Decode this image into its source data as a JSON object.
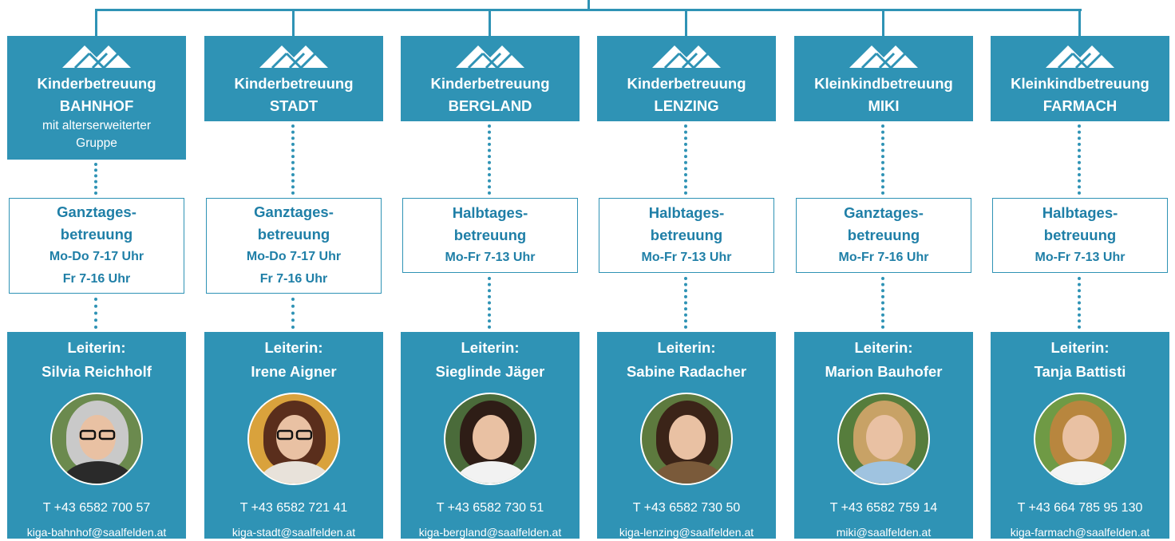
{
  "colors": {
    "accent": "#2f93b5",
    "text_mid": "#1f7fa7",
    "white": "#ffffff"
  },
  "units": [
    {
      "title_line1": "Kinderbetreuung",
      "title_line2": "BAHNHOF",
      "subtitle": "mit alterserweiterter Gruppe",
      "care_type": [
        "Ganztages-",
        "betreuung"
      ],
      "hours": [
        "Mo-Do 7-17 Uhr",
        "Fr 7-16 Uhr"
      ],
      "leader_label": "Leiterin:",
      "leader_name": "Silvia Reichholf",
      "phone": "T +43 6582 700 57",
      "email": "kiga-bahnhof@saalfelden.at",
      "photo": {
        "bg": "#6b8a4e",
        "hair": "#c9c9c9",
        "body": "#2a2a2a",
        "glasses": true
      }
    },
    {
      "title_line1": "Kinderbetreuung",
      "title_line2": "STADT",
      "subtitle": "",
      "care_type": [
        "Ganztages-",
        "betreuung"
      ],
      "hours": [
        "Mo-Do 7-17 Uhr",
        "Fr 7-16 Uhr"
      ],
      "leader_label": "Leiterin:",
      "leader_name": "Irene Aigner",
      "phone": "T +43 6582 721 41",
      "email": "kiga-stadt@saalfelden.at",
      "photo": {
        "bg": "#d9a23c",
        "hair": "#5a2e1c",
        "body": "#e8e2da",
        "glasses": true
      }
    },
    {
      "title_line1": "Kinderbetreuung",
      "title_line2": "BERGLAND",
      "subtitle": "",
      "care_type": [
        "Halbtages-",
        "betreuung"
      ],
      "hours": [
        "Mo-Fr 7-13 Uhr"
      ],
      "leader_label": "Leiterin:",
      "leader_name": "Sieglinde Jäger",
      "phone": "T +43 6582 730 51",
      "email": "kiga-bergland@saalfelden.at",
      "photo": {
        "bg": "#4a6b3a",
        "hair": "#2e1d16",
        "body": "#f2f2f2",
        "glasses": false
      }
    },
    {
      "title_line1": "Kinderbetreuung",
      "title_line2": "LENZING",
      "subtitle": "",
      "care_type": [
        "Halbtages-",
        "betreuung"
      ],
      "hours": [
        "Mo-Fr 7-13 Uhr"
      ],
      "leader_label": "Leiterin:",
      "leader_name": "Sabine Radacher",
      "phone": "T +43 6582 730 50",
      "email": "kiga-lenzing@saalfelden.at",
      "photo": {
        "bg": "#5d7a3e",
        "hair": "#3b2418",
        "body": "#7a5a3a",
        "glasses": false
      }
    },
    {
      "title_line1": "Kleinkindbetreuung",
      "title_line2": "MIKI",
      "subtitle": "",
      "care_type": [
        "Ganztages-",
        "betreuung"
      ],
      "hours": [
        "Mo-Fr 7-16 Uhr"
      ],
      "leader_label": "Leiterin:",
      "leader_name": "Marion Bauhofer",
      "phone": "T +43 6582 759 14",
      "email": "miki@saalfelden.at",
      "photo": {
        "bg": "#567d3c",
        "hair": "#c8a266",
        "body": "#9fc3e0",
        "glasses": false
      }
    },
    {
      "title_line1": "Kleinkindbetreuung",
      "title_line2": "FARMACH",
      "subtitle": "",
      "care_type": [
        "Halbtages-",
        "betreuung"
      ],
      "hours": [
        "Mo-Fr 7-13 Uhr"
      ],
      "leader_label": "Leiterin:",
      "leader_name": "Tanja Battisti",
      "phone": "T +43 664 785 95 130",
      "email": "kiga-farmach@saalfelden.at",
      "photo": {
        "bg": "#6f9a45",
        "hair": "#b8863e",
        "body": "#f3f3f3",
        "glasses": false
      }
    }
  ]
}
